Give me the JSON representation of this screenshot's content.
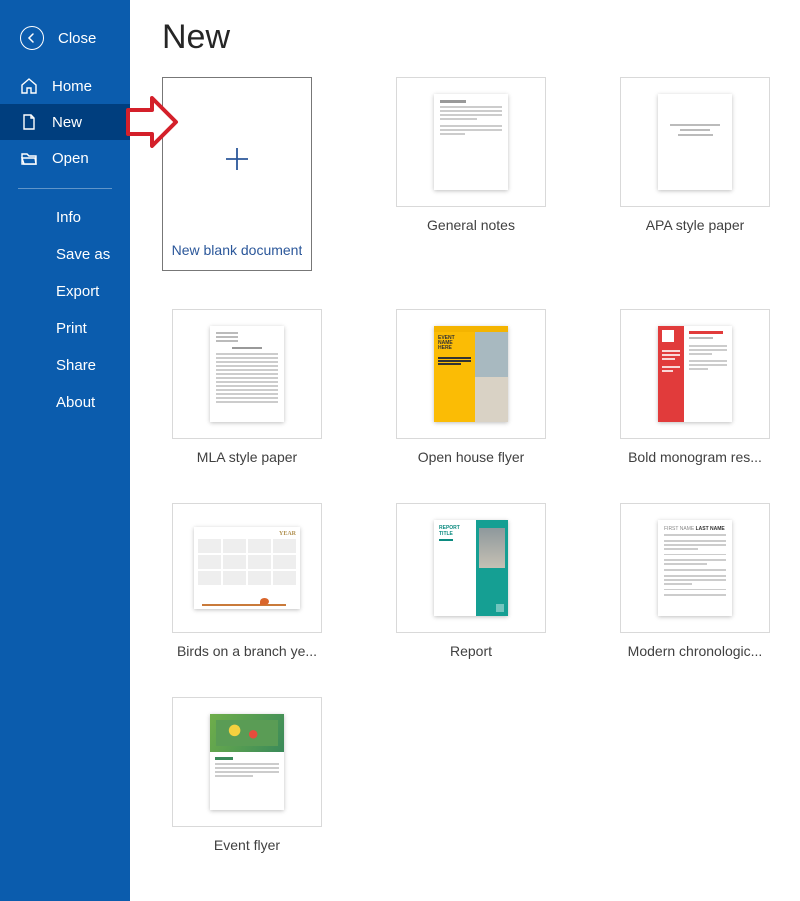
{
  "close_label": "Close",
  "sidebar": {
    "primary": [
      {
        "label": "Home"
      },
      {
        "label": "New"
      },
      {
        "label": "Open"
      }
    ],
    "secondary": [
      {
        "label": "Info"
      },
      {
        "label": "Save as"
      },
      {
        "label": "Export"
      },
      {
        "label": "Print"
      },
      {
        "label": "Share"
      },
      {
        "label": "About"
      }
    ]
  },
  "main": {
    "title": "New",
    "templates": [
      {
        "label": "New blank document"
      },
      {
        "label": "General notes"
      },
      {
        "label": "APA style paper"
      },
      {
        "label": "MLA style paper"
      },
      {
        "label": "Open house flyer"
      },
      {
        "label": "Bold monogram res..."
      },
      {
        "label": "Birds on a branch ye..."
      },
      {
        "label": "Report"
      },
      {
        "label": "Modern chronologic..."
      },
      {
        "label": "Event flyer"
      }
    ]
  }
}
